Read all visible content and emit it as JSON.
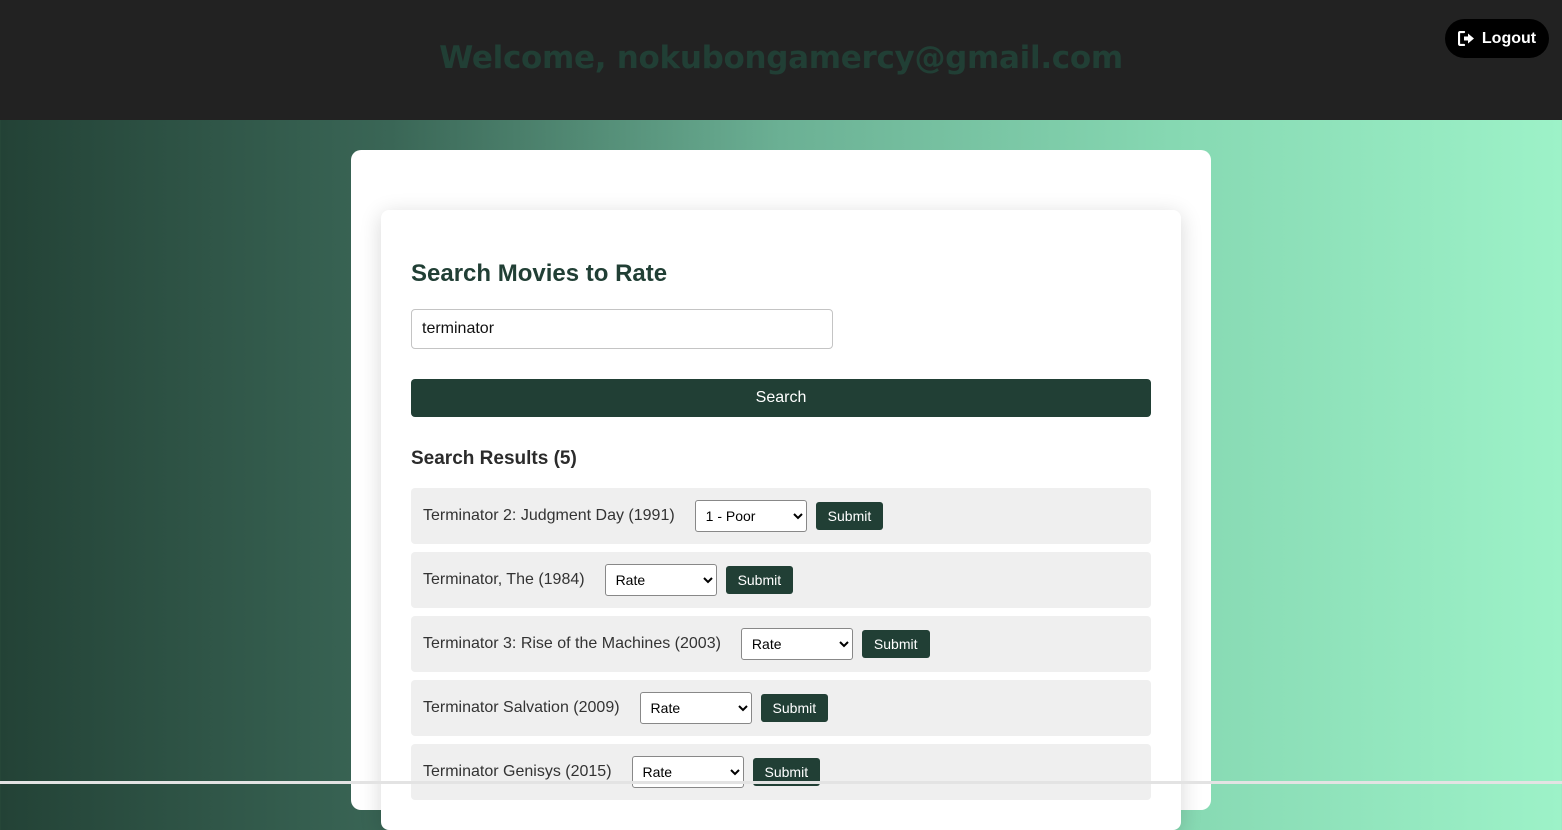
{
  "header": {
    "welcome_text": "Welcome, nokubongamercy@gmail.com",
    "logout_label": "Logout",
    "logout_icon": "logout-icon"
  },
  "search": {
    "heading": "Search Movies to Rate",
    "query_value": "terminator",
    "button_label": "Search"
  },
  "results": {
    "heading": "Search Results (5)",
    "items": [
      {
        "title": "Terminator 2: Judgment Day (1991)",
        "selected": "1 - Poor",
        "submit_label": "Submit"
      },
      {
        "title": "Terminator, The (1984)",
        "selected": "Rate",
        "submit_label": "Submit"
      },
      {
        "title": "Terminator 3: Rise of the Machines (2003)",
        "selected": "Rate",
        "submit_label": "Submit"
      },
      {
        "title": "Terminator Salvation (2009)",
        "selected": "Rate",
        "submit_label": "Submit"
      },
      {
        "title": "Terminator Genisys (2015)",
        "selected": "Rate",
        "submit_label": "Submit"
      }
    ]
  },
  "colors": {
    "accent": "#213f35",
    "topbar": "#222222",
    "gradient_start": "#234236",
    "gradient_end": "#9df2c8"
  }
}
